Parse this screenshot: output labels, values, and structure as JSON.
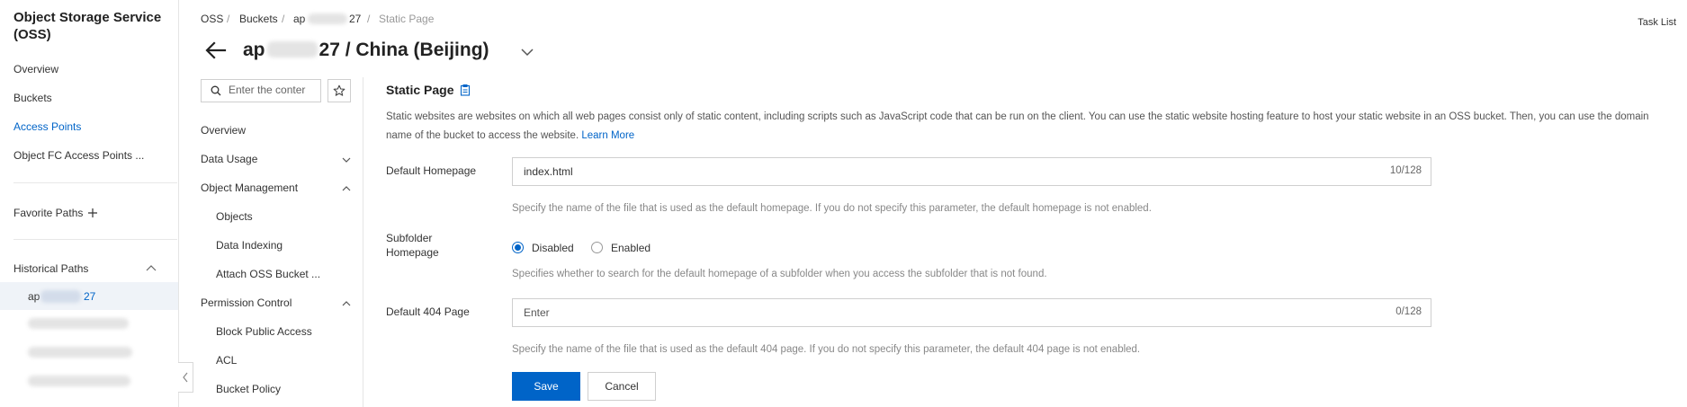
{
  "colors": {
    "accent": "#0064c8",
    "border": "#cfcfcf",
    "selected_bg": "#eff3f8"
  },
  "left_nav": {
    "service_title": "Object Storage Service (OSS)",
    "items": [
      {
        "label": "Overview",
        "active": false
      },
      {
        "label": "Buckets",
        "active": false
      },
      {
        "label": "Access Points",
        "active": true
      },
      {
        "label": "Object FC Access Points ...",
        "active": false
      }
    ],
    "favorite_paths_label": "Favorite Paths",
    "favorite_add_icon": "plus-icon",
    "historical_paths_label": "Historical Paths",
    "historical_toggle_icon": "chevron-up-icon",
    "historical_selected": {
      "prefix": "ap",
      "suffix": "27"
    },
    "collapse_icon": "chevron-left-icon"
  },
  "breadcrumb": {
    "items": [
      "OSS",
      "Buckets",
      "ap",
      "27",
      "Static Page"
    ],
    "separator": "/"
  },
  "header": {
    "back_icon": "arrow-left-icon",
    "title_prefix": "ap",
    "title_suffix": "27 / China (Beijing)",
    "region_dropdown_icon": "chevron-down-icon",
    "task_list": "Task List"
  },
  "sub_nav": {
    "search_placeholder": "Enter the conter",
    "search_icon": "search-icon",
    "favorite_icon": "star-icon",
    "items": [
      {
        "label": "Overview",
        "level": 0
      },
      {
        "label": "Data Usage",
        "level": 0,
        "chevron": "chevron-down-icon"
      },
      {
        "label": "Object Management",
        "level": 0,
        "chevron": "chevron-up-icon"
      },
      {
        "label": "Objects",
        "level": 1
      },
      {
        "label": "Data Indexing",
        "level": 1
      },
      {
        "label": "Attach OSS Bucket ...",
        "level": 1
      },
      {
        "label": "Permission Control",
        "level": 0,
        "chevron": "chevron-up-icon"
      },
      {
        "label": "Block Public Access",
        "level": 1
      },
      {
        "label": "ACL",
        "level": 1
      },
      {
        "label": "Bucket Policy",
        "level": 1
      }
    ]
  },
  "content": {
    "title": "Static Page",
    "title_icon": "clipboard-icon",
    "description": "Static websites are websites on which all web pages consist only of static content, including scripts such as JavaScript code that can be run on the client. You can use the static website hosting feature to host your static website in an OSS bucket. Then, you can use the domain name of the bucket to access the website.",
    "learn_more": "Learn More",
    "default_homepage": {
      "label": "Default Homepage",
      "value": "index.html",
      "counter": "10/128",
      "help": "Specify the name of the file that is used as the default homepage. If you do not specify this parameter, the default homepage is not enabled."
    },
    "subfolder_homepage": {
      "label_line1": "Subfolder",
      "label_line2": "Homepage",
      "options": [
        "Disabled",
        "Enabled"
      ],
      "selected": "Disabled",
      "help": "Specifies whether to search for the default homepage of a subfolder when you access the subfolder that is not found."
    },
    "default_404": {
      "label": "Default 404 Page",
      "placeholder": "Enter",
      "value": "",
      "counter": "0/128",
      "help": "Specify the name of the file that is used as the default 404 page. If you do not specify this parameter, the default 404 page is not enabled."
    },
    "save_label": "Save",
    "cancel_label": "Cancel"
  }
}
